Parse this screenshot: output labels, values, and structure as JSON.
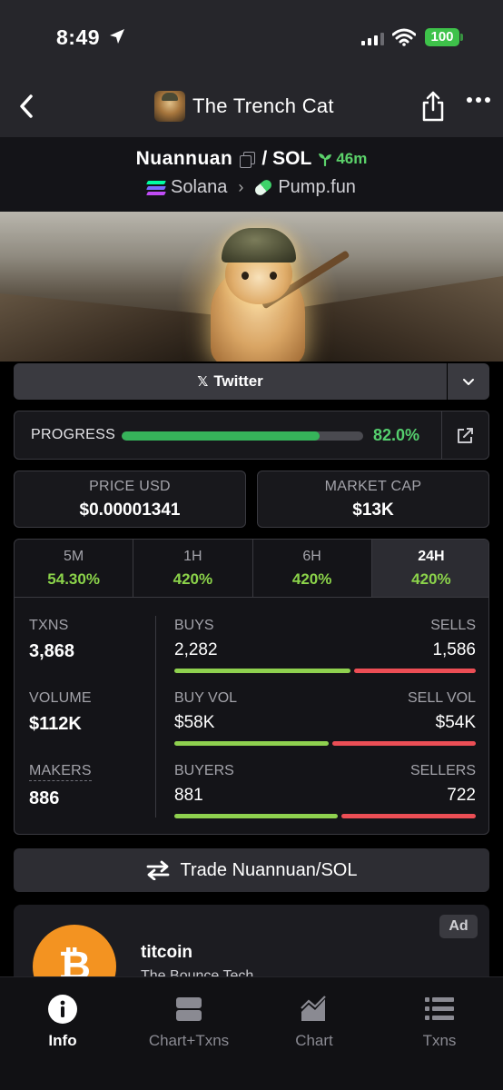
{
  "status": {
    "time": "8:49",
    "battery": "100"
  },
  "nav": {
    "title": "The Trench Cat"
  },
  "token": {
    "base": "Nuannuan",
    "separator": "/",
    "quote": "SOL",
    "age": "46m",
    "chain": "Solana",
    "dex": "Pump.fun"
  },
  "links": {
    "twitter_label": "Twitter"
  },
  "progress": {
    "label": "PROGRESS",
    "value_text": "82.0%",
    "value": 0.82
  },
  "price": {
    "label": "PRICE USD",
    "value": "$0.00001341"
  },
  "market_cap": {
    "label": "MARKET CAP",
    "value": "$13K"
  },
  "timeframes": [
    {
      "label": "5M",
      "change": "54.30%"
    },
    {
      "label": "1H",
      "change": "420%"
    },
    {
      "label": "6H",
      "change": "420%"
    },
    {
      "label": "24H",
      "change": "420%",
      "active": true
    }
  ],
  "stats": {
    "txns": {
      "label": "TXNS",
      "value": "3,868"
    },
    "volume": {
      "label": "VOLUME",
      "value": "$112K"
    },
    "makers": {
      "label": "MAKERS",
      "value": "886"
    },
    "buys": {
      "label": "BUYS",
      "value": "2,282",
      "num": 2282
    },
    "sells": {
      "label": "SELLS",
      "value": "1,586",
      "num": 1586
    },
    "buy_vol": {
      "label": "BUY VOL",
      "value": "$58K",
      "num": 58
    },
    "sell_vol": {
      "label": "SELL VOL",
      "value": "$54K",
      "num": 54
    },
    "buyers": {
      "label": "BUYERS",
      "value": "881",
      "num": 881
    },
    "sellers": {
      "label": "SELLERS",
      "value": "722",
      "num": 722
    }
  },
  "trade": {
    "label": "Trade Nuannuan/SOL"
  },
  "ad": {
    "badge": "Ad",
    "title": "titcoin",
    "subtitle": "The Bounce Tech"
  },
  "tabs": [
    {
      "label": "Info",
      "icon": "info-icon",
      "active": true
    },
    {
      "label": "Chart+Txns",
      "icon": "split-layout-icon"
    },
    {
      "label": "Chart",
      "icon": "area-chart-icon"
    },
    {
      "label": "Txns",
      "icon": "list-icon"
    }
  ],
  "colors": {
    "buy": "#8fd14f",
    "sell": "#ec4e55",
    "positive": "#8bd34a",
    "progress": "#36b35a",
    "ad_logo": "#f39321"
  }
}
